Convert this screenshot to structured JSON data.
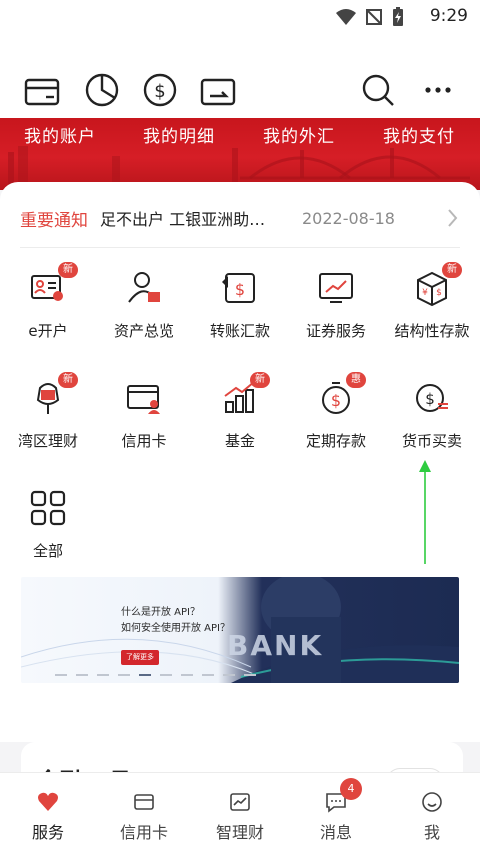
{
  "status": {
    "time": "9:29"
  },
  "topbar": {
    "icons": [
      "wallet-icon",
      "pie-chart-icon",
      "dollar-circle-icon",
      "transfer-card-icon",
      "search-icon",
      "more-icon"
    ]
  },
  "hero": {
    "tabs": [
      "我的账户",
      "我的明细",
      "我的外汇",
      "我的支付"
    ]
  },
  "notice": {
    "tag": "重要通知",
    "text": "足不出户 工银亚洲助…",
    "date": "2022-08-18"
  },
  "services": [
    {
      "label": "e开户",
      "icon": "id-card-icon",
      "badge": "新"
    },
    {
      "label": "资产总览",
      "icon": "person-icon",
      "badge": ""
    },
    {
      "label": "转账汇款",
      "icon": "transfer-icon",
      "badge": ""
    },
    {
      "label": "证券服务",
      "icon": "trend-monitor-icon",
      "badge": ""
    },
    {
      "label": "结构性存款",
      "icon": "box-icon",
      "badge": "新"
    },
    {
      "label": "湾区理财",
      "icon": "flower-icon",
      "badge": "新"
    },
    {
      "label": "信用卡",
      "icon": "credit-card-icon",
      "badge": ""
    },
    {
      "label": "基金",
      "icon": "growth-chart-icon",
      "badge": "新"
    },
    {
      "label": "定期存款",
      "icon": "stopwatch-dollar-icon",
      "badge": "惠"
    },
    {
      "label": "货币买卖",
      "icon": "currency-exchange-icon",
      "badge": ""
    },
    {
      "label": "全部",
      "icon": "grid-icon",
      "badge": ""
    }
  ],
  "banner": {
    "line1": "什么是开放 API？",
    "line2": "如何安全使用开放 API？",
    "button": "了解更多",
    "image_text": "BANK"
  },
  "lower": {
    "title": "金融工具"
  },
  "tabbar": {
    "tabs": [
      {
        "label": "服务",
        "icon": "heart-icon"
      },
      {
        "label": "信用卡",
        "icon": "card-icon"
      },
      {
        "label": "智理财",
        "icon": "chart-icon"
      },
      {
        "label": "消息",
        "icon": "message-icon"
      },
      {
        "label": "我",
        "icon": "smile-icon"
      }
    ],
    "message_badge": "4"
  },
  "colors": {
    "brand": "#c8161d",
    "accent": "#e0453e",
    "arrow": "#2ecc40"
  }
}
